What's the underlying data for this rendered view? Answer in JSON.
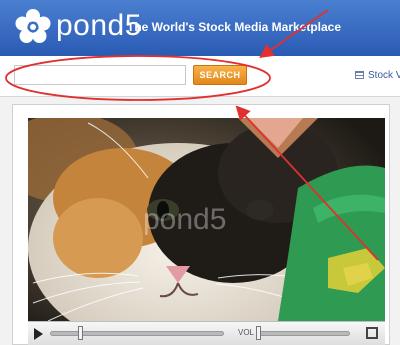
{
  "header": {
    "logo_text": "pond5",
    "tagline": "The World's Stock Media Marketplace",
    "logo_icon": "flower-icon",
    "background_color": "#2f63bd"
  },
  "search": {
    "input_value": "",
    "placeholder": "",
    "button_label": "SEARCH",
    "button_color": "#f0a030"
  },
  "nav": {
    "link_label": "Stock V",
    "link_icon": "film-icon"
  },
  "video": {
    "watermark": "pond5",
    "play_icon": "play-icon",
    "fullscreen_icon": "fullscreen-icon",
    "volume_label": "VOL",
    "seek_progress": 0.17,
    "volume_level": 0.0
  },
  "annotations": {
    "color": "#e03030"
  }
}
